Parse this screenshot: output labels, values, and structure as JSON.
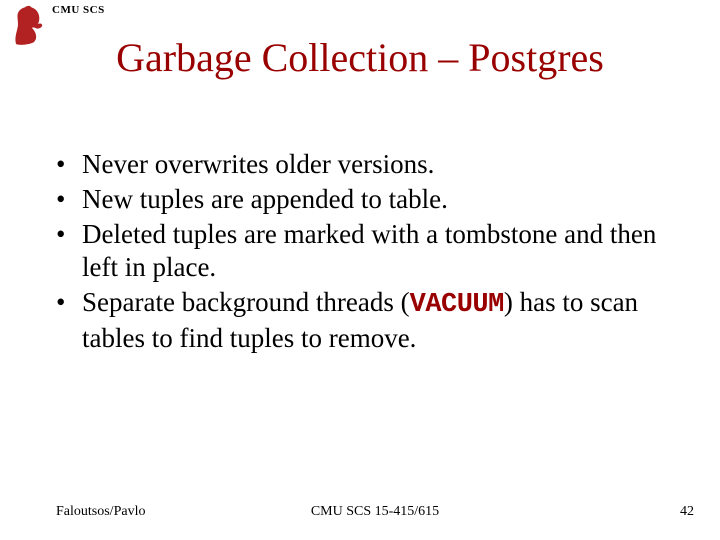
{
  "header": {
    "label": "CMU SCS"
  },
  "title": "Garbage Collection – Postgres",
  "bullets": [
    {
      "text": "Never overwrites older versions."
    },
    {
      "text": "New tuples are appended to table."
    },
    {
      "text": "Deleted tuples are marked with a tombstone and then left in place."
    },
    {
      "pre": "Separate background threads (",
      "code": "VACUUM",
      "post": ") has to scan tables to find tuples to remove."
    }
  ],
  "footer": {
    "left": "Faloutsos/Pavlo",
    "center": "CMU SCS 15-415/615",
    "right": "42"
  }
}
